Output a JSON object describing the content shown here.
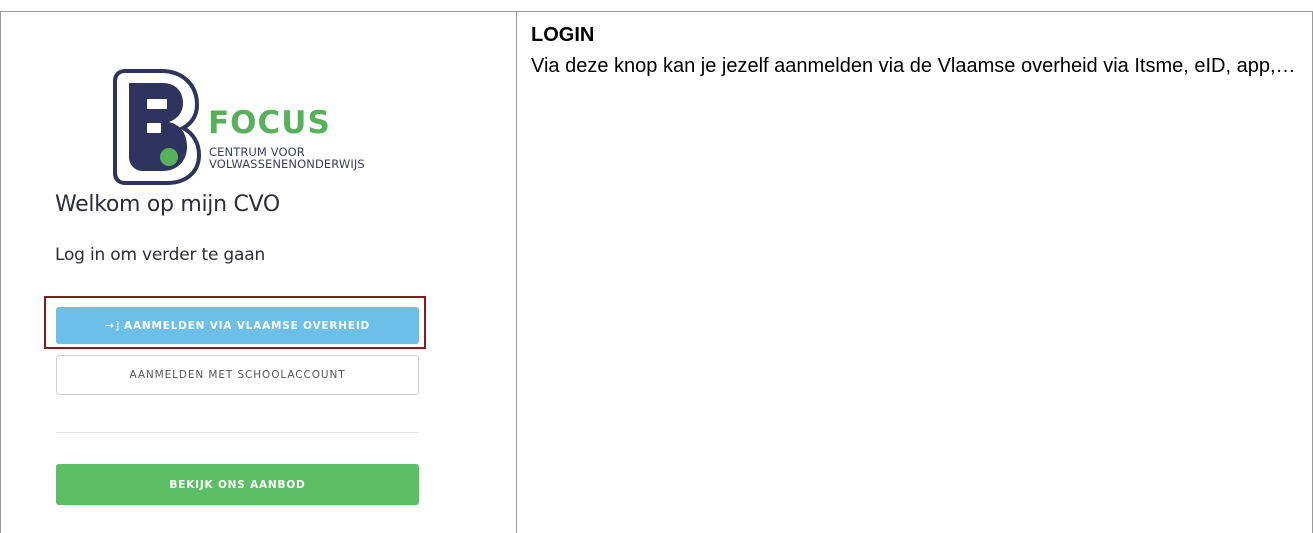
{
  "login": {
    "logo": {
      "word": "FOCUS",
      "subtitle_line1": "CENTRUM VOOR",
      "subtitle_line2": "VOLWASSENENONDERWIJS",
      "brand_dark": "#2e3360",
      "brand_green": "#55b25a"
    },
    "welcome": "Welkom op mijn CVO",
    "subtitle": "Log in om verder te gaan",
    "buttons": {
      "vlaams_icon": "→]",
      "vlaams_label": "AANMELDEN VIA VLAAMSE OVERHEID",
      "school_label": "AANMELDEN MET SCHOOLACCOUNT",
      "aanbod_label": "BEKIJK ONS AANBOD"
    },
    "colors": {
      "vlaams_button": "#6bbfe9",
      "aanbod_button": "#5cbf63",
      "highlight_border": "#8b1a1a"
    }
  },
  "description": {
    "title": "LOGIN",
    "body": "Via deze knop kan je jezelf aanmelden via de Vlaamse overheid via Itsme, eID, app,…"
  }
}
